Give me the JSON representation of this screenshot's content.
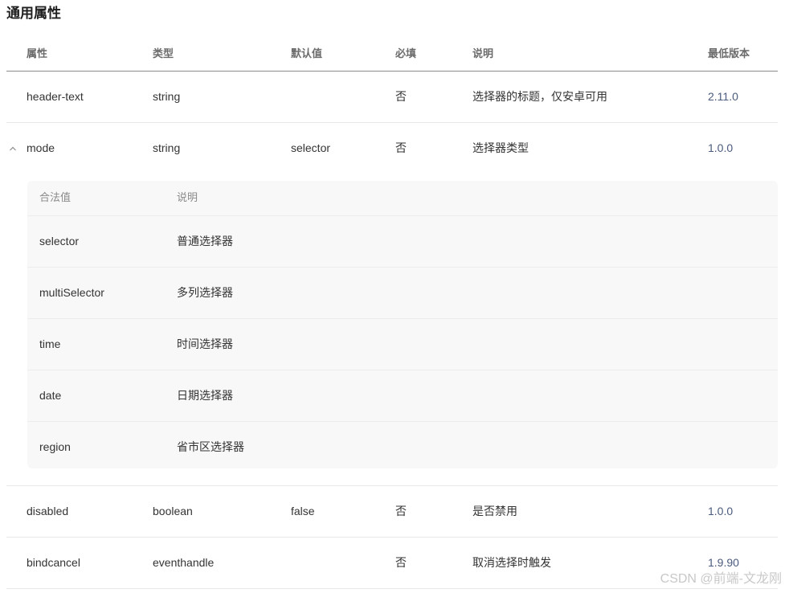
{
  "page": {
    "title": "通用属性"
  },
  "table": {
    "headers": {
      "name": "属性",
      "type": "类型",
      "default": "默认值",
      "required": "必填",
      "description": "说明",
      "version": "最低版本"
    },
    "rows": [
      {
        "name": "header-text",
        "type": "string",
        "default": "",
        "required": "否",
        "description": "选择器的标题，仅安卓可用",
        "version": "2.11.0"
      },
      {
        "name": "mode",
        "type": "string",
        "default": "selector",
        "required": "否",
        "description": "选择器类型",
        "version": "1.0.0",
        "expanded": true,
        "sub_table": {
          "headers": {
            "value": "合法值",
            "description": "说明"
          },
          "rows": [
            {
              "value": "selector",
              "description": "普通选择器"
            },
            {
              "value": "multiSelector",
              "description": "多列选择器"
            },
            {
              "value": "time",
              "description": "时间选择器"
            },
            {
              "value": "date",
              "description": "日期选择器"
            },
            {
              "value": "region",
              "description": "省市区选择器"
            }
          ]
        }
      },
      {
        "name": "disabled",
        "type": "boolean",
        "default": "false",
        "required": "否",
        "description": "是否禁用",
        "version": "1.0.0"
      },
      {
        "name": "bindcancel",
        "type": "eventhandle",
        "default": "",
        "required": "否",
        "description": "取消选择时触发",
        "version": "1.9.90"
      }
    ]
  },
  "watermark": "CSDN @前端-文龙刚",
  "icons": {
    "expand": "chevron-up-icon"
  }
}
